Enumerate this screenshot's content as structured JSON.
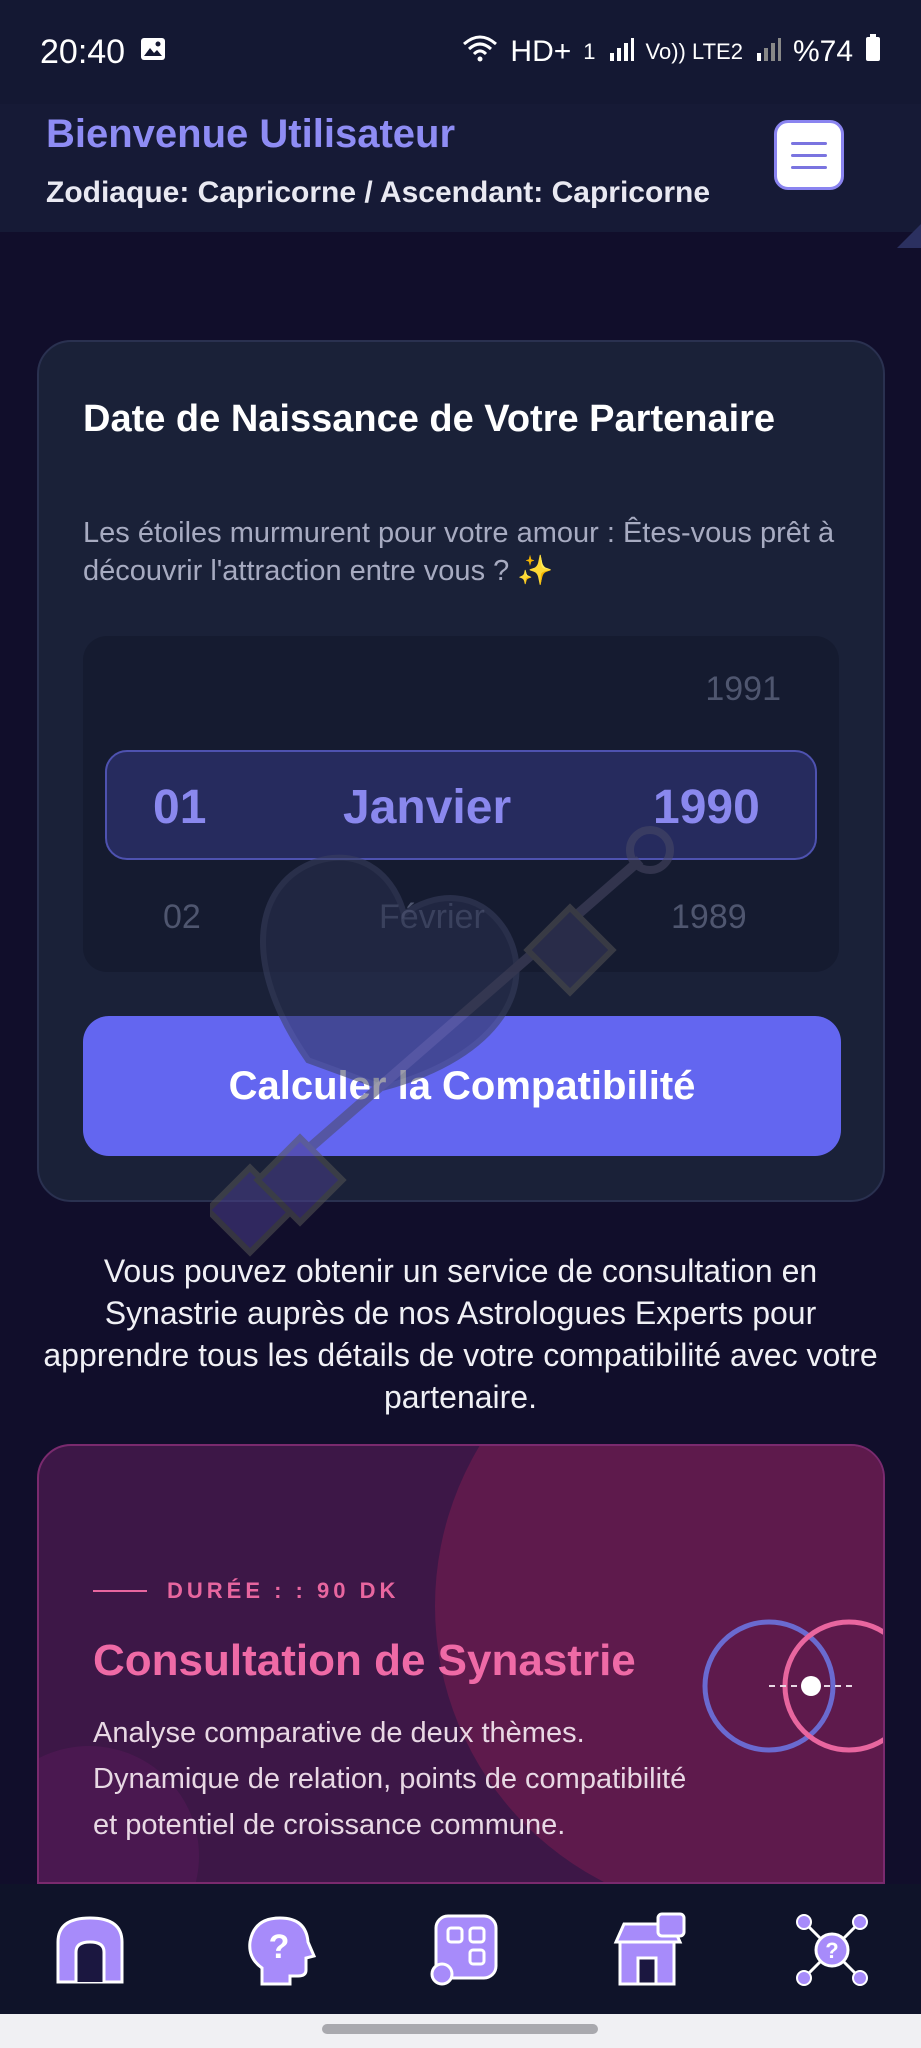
{
  "status_bar": {
    "time": "20:40",
    "network": "HD+",
    "network_sub": "1",
    "lte_label": "Vo)) LTE2",
    "battery": "%74"
  },
  "header": {
    "title": "Bienvenue Utilisateur",
    "subtitle": "Zodiaque: Capricorne / Ascendant: Capricorne"
  },
  "partner_card": {
    "title": "Date de Naissance de Votre Partenaire",
    "description": "Les étoiles murmurent pour votre amour : Êtes-vous prêt à découvrir l'attraction entre vous ? ✨",
    "picker": {
      "year_above": "1991",
      "selected_day": "01",
      "selected_month": "Janvier",
      "selected_year": "1990",
      "day_below": "02",
      "month_below": "Février",
      "year_below": "1989"
    },
    "button_label": "Calculer la Compatibilité"
  },
  "info_text": "Vous pouvez obtenir un service de consultation en Synastrie auprès de nos Astrologues Experts pour apprendre tous les détails de votre compatibilité avec votre partenaire.",
  "offer": {
    "duration": "DURÉE : : 90 DK",
    "title": "Consultation de Synastrie",
    "description": "Analyse comparative de deux thèmes. Dynamique de relation, points de compatibilité et potentiel de croissance commune."
  },
  "colors": {
    "accent": "#6366f0",
    "offer_pink": "#ef6aa6",
    "nav_icon": "#a78bfa"
  },
  "bottom_nav": [
    {
      "icon": "home-icon"
    },
    {
      "icon": "question-head-icon"
    },
    {
      "icon": "apps-icon"
    },
    {
      "icon": "shop-icon"
    },
    {
      "icon": "network-help-icon"
    }
  ]
}
